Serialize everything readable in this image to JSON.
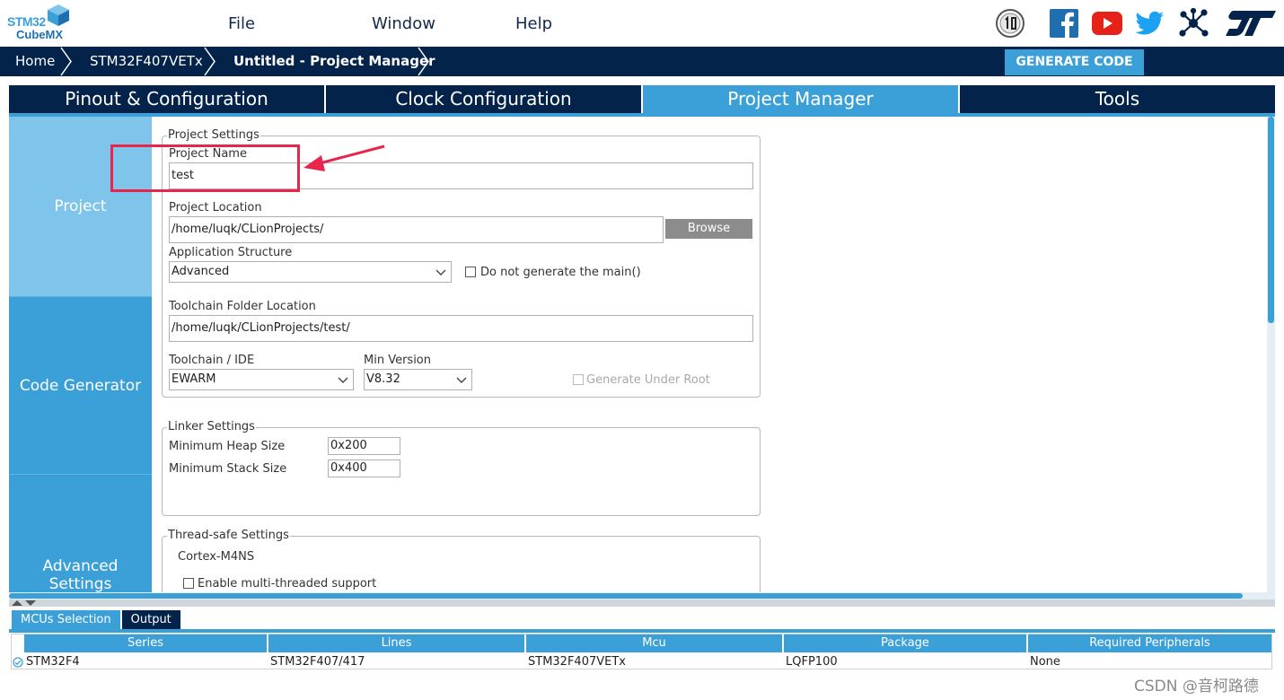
{
  "app": {
    "logo_top": "STM32",
    "logo_bottom": "CubeMX",
    "menu": [
      "File",
      "Window",
      "Help"
    ]
  },
  "breadcrumb": {
    "items": [
      "Home",
      "STM32F407VETx",
      "Untitled - Project Manager"
    ],
    "generate_label": "GENERATE CODE"
  },
  "tabs": [
    "Pinout & Configuration",
    "Clock Configuration",
    "Project Manager",
    "Tools"
  ],
  "active_tab": "Project Manager",
  "subnav": [
    "Project",
    "Code Generator",
    "Advanced Settings"
  ],
  "project_settings": {
    "legend": "Project Settings",
    "project_name_label": "Project Name",
    "project_name_value": "test",
    "project_location_label": "Project Location",
    "project_location_value": "/home/luqk/CLionProjects/",
    "browse_label": "Browse",
    "app_structure_label": "Application Structure",
    "app_structure_value": "Advanced",
    "no_main_label": "Do not generate the main()",
    "toolchain_folder_label": "Toolchain Folder Location",
    "toolchain_folder_value": "/home/luqk/CLionProjects/test/",
    "toolchain_label": "Toolchain / IDE",
    "toolchain_value": "EWARM",
    "min_version_label": "Min Version",
    "min_version_value": "V8.32",
    "generate_under_root_label": "Generate Under Root"
  },
  "linker_settings": {
    "legend": "Linker Settings",
    "heap_label": "Minimum Heap Size",
    "heap_value": "0x200",
    "stack_label": "Minimum Stack Size",
    "stack_value": "0x400"
  },
  "thread_settings": {
    "legend": "Thread-safe Settings",
    "core": "Cortex-M4NS",
    "multi_thread_label": "Enable multi-threaded support"
  },
  "bottom": {
    "tabs": [
      "MCUs Selection",
      "Output"
    ],
    "columns": [
      "Series",
      "Lines",
      "Mcu",
      "Package",
      "Required Peripherals"
    ],
    "row": [
      "STM32F4",
      "STM32F407/417",
      "STM32F407VETx",
      "LQFP100",
      "None"
    ]
  },
  "watermark": "CSDN @音柯路德",
  "colors": {
    "navy": "#03234b",
    "accent": "#3ca0d8",
    "annotation": "#e8254a"
  }
}
